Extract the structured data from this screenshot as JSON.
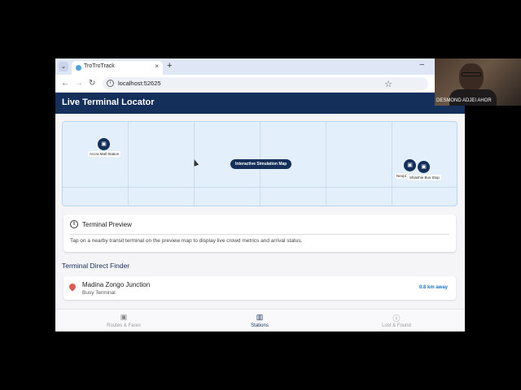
{
  "browser": {
    "tab_title": "TroTroTrack",
    "tab_close": "×",
    "new_tab": "+",
    "url": "localhost:52625",
    "minimize": "–",
    "menu_icon": "chevron-down-icon",
    "back_icon": "←",
    "forward_icon": "→",
    "reload_icon": "↻",
    "star_icon": "☆"
  },
  "app": {
    "title": "Live Terminal Locator",
    "map": {
      "center_label": "Interactive Simulation Map",
      "pins": [
        {
          "name": "Accra Mall Station"
        },
        {
          "name": "Neopl"
        },
        {
          "name": "Shiashie Bus Stop"
        }
      ]
    },
    "preview": {
      "title": "Terminal Preview",
      "text": "Tap on a nearby transit terminal on the preview map to display live crowd metrics and arrival status."
    },
    "finder": {
      "title": "Terminal Direct Finder",
      "terminals": [
        {
          "name": "Madina Zongo Junction",
          "type": "Busy Terminal",
          "distance": "0.8 km away"
        }
      ]
    },
    "bottom_nav": [
      {
        "label": "Routes & Fares",
        "icon": "bus-icon",
        "active": false
      },
      {
        "label": "Stations",
        "icon": "map-icon",
        "active": true
      },
      {
        "label": "Lost & Found",
        "icon": "alert-icon",
        "active": false
      }
    ]
  },
  "webcam": {
    "name": "DESMOND ADJEI AHOR"
  },
  "colors": {
    "primary": "#132f5a",
    "map_bg": "#e3f0fb",
    "distance": "#1a76c9",
    "location_pin": "#e05a4f"
  }
}
